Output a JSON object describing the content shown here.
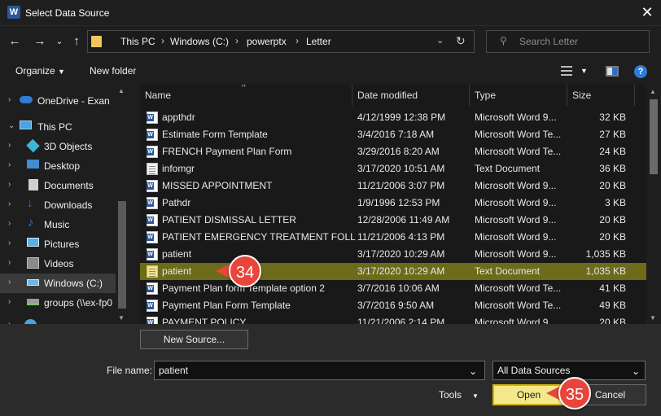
{
  "window": {
    "title": "Select Data Source",
    "app_icon": "W"
  },
  "nav": {
    "back": "←",
    "forward": "→",
    "recent": "⌄",
    "up": "↑",
    "breadcrumbs": [
      "This PC",
      "Windows (C:)",
      "powerptx",
      "Letter"
    ],
    "separator": "›",
    "search_placeholder": "Search Letter"
  },
  "toolbar": {
    "organize": "Organize",
    "new_folder": "New folder",
    "help": "?"
  },
  "sidebar": {
    "items": [
      {
        "label": "OneDrive - Exan",
        "icon": "cloud-icon",
        "color": "#2f7bd8"
      },
      {
        "label": "This PC",
        "icon": "computer-icon",
        "color": "#4aa3df"
      },
      {
        "label": "3D Objects",
        "icon": "cube-icon",
        "color": "#3fb6d6"
      },
      {
        "label": "Desktop",
        "icon": "desktop-icon",
        "color": "#3e8ed0"
      },
      {
        "label": "Documents",
        "icon": "document-icon",
        "color": "#d0d0d0"
      },
      {
        "label": "Downloads",
        "icon": "download-icon",
        "color": "#2f7bd8"
      },
      {
        "label": "Music",
        "icon": "music-icon",
        "color": "#2f7bd8"
      },
      {
        "label": "Pictures",
        "icon": "pictures-icon",
        "color": "#5ab0e0"
      },
      {
        "label": "Videos",
        "icon": "video-icon",
        "color": "#8a8a8a"
      },
      {
        "label": "Windows (C:)",
        "icon": "drive-icon",
        "color": "#6fb6e6"
      },
      {
        "label": "groups (\\\\ex-fp0",
        "icon": "network-drive-icon",
        "color": "#7ac36a"
      }
    ]
  },
  "columns": {
    "name": "Name",
    "date": "Date modified",
    "type": "Type",
    "size": "Size"
  },
  "files": [
    {
      "name": "appthdr",
      "date": "4/12/1999 12:38 PM",
      "type": "Microsoft Word 9...",
      "size": "32 KB",
      "icon": "word-doc-icon"
    },
    {
      "name": "Estimate Form Template",
      "date": "3/4/2016 7:18 AM",
      "type": "Microsoft Word Te...",
      "size": "27 KB",
      "icon": "word-doc-icon"
    },
    {
      "name": "FRENCH Payment Plan Form",
      "date": "3/29/2016 8:20 AM",
      "type": "Microsoft Word Te...",
      "size": "24 KB",
      "icon": "word-doc-icon"
    },
    {
      "name": "infomgr",
      "date": "3/17/2020 10:51 AM",
      "type": "Text Document",
      "size": "36 KB",
      "icon": "text-doc-icon"
    },
    {
      "name": "MISSED APPOINTMENT",
      "date": "11/21/2006 3:07 PM",
      "type": "Microsoft Word 9...",
      "size": "20 KB",
      "icon": "word-doc-icon"
    },
    {
      "name": "Pathdr",
      "date": "1/9/1996 12:53 PM",
      "type": "Microsoft Word 9...",
      "size": "3 KB",
      "icon": "word-doc-icon"
    },
    {
      "name": "PATIENT DISMISSAL LETTER",
      "date": "12/28/2006 11:49 AM",
      "type": "Microsoft Word 9...",
      "size": "20 KB",
      "icon": "word-doc-icon"
    },
    {
      "name": "PATIENT EMERGENCY TREATMENT FOLL...",
      "date": "11/21/2006 4:13 PM",
      "type": "Microsoft Word 9...",
      "size": "20 KB",
      "icon": "word-doc-icon"
    },
    {
      "name": "patient",
      "date": "3/17/2020 10:29 AM",
      "type": "Microsoft Word 9...",
      "size": "1,035 KB",
      "icon": "word-doc-icon"
    },
    {
      "name": "patient",
      "date": "3/17/2020 10:29 AM",
      "type": "Text Document",
      "size": "1,035 KB",
      "icon": "text-doc-icon",
      "selected": true
    },
    {
      "name": "Payment Plan form Template option 2",
      "date": "3/7/2016 10:06 AM",
      "type": "Microsoft Word Te...",
      "size": "41 KB",
      "icon": "word-doc-icon"
    },
    {
      "name": "Payment Plan Form Template",
      "date": "3/7/2016 9:50 AM",
      "type": "Microsoft Word Te...",
      "size": "49 KB",
      "icon": "word-doc-icon"
    },
    {
      "name": "PAYMENT POLICY",
      "date": "11/21/2006 2:14 PM",
      "type": "Microsoft Word 9...",
      "size": "20 KB",
      "icon": "word-doc-icon"
    }
  ],
  "bottom": {
    "new_source": "New Source...",
    "file_name_label": "File name:",
    "file_name_value": "patient",
    "filter_value": "All Data Sources",
    "tools": "Tools",
    "open": "Open",
    "cancel": "Cancel"
  },
  "callouts": {
    "step_a": "34",
    "step_b": "35",
    "color": "#e8463a"
  },
  "colors": {
    "selection": "#6b6b1a",
    "primary_button": "#f5e88a",
    "primary_border": "#d6b400"
  }
}
